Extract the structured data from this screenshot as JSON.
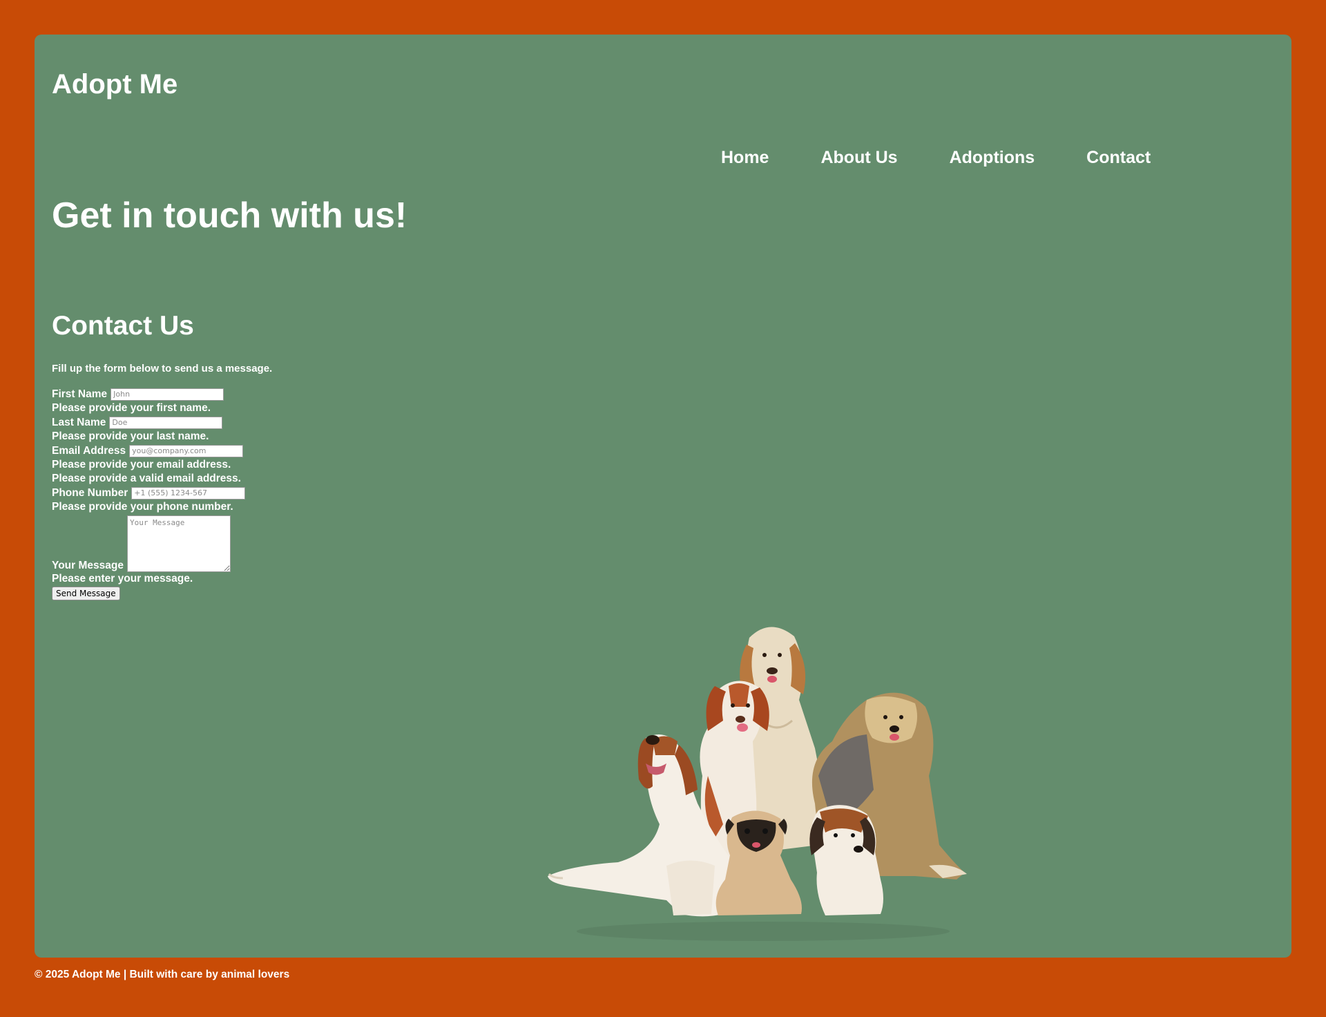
{
  "header": {
    "site_title": "Adopt Me"
  },
  "nav": {
    "items": [
      "Home",
      "About Us",
      "Adoptions",
      "Contact"
    ]
  },
  "hero": {
    "title": "Get in touch with us!"
  },
  "contact": {
    "heading": "Contact Us",
    "intro": "Fill up the form below to send us a message.",
    "first_name": {
      "label": "First Name",
      "placeholder": "John",
      "message": "Please provide your first name."
    },
    "last_name": {
      "label": "Last Name",
      "placeholder": "Doe",
      "message": "Please provide your last name."
    },
    "email": {
      "label": "Email Address",
      "placeholder": "you@company.com",
      "message_required": "Please provide your email address.",
      "message_invalid": "Please provide a valid email address."
    },
    "phone": {
      "label": "Phone Number",
      "placeholder": "+1 (555) 1234-567",
      "message": "Please provide your phone number."
    },
    "message": {
      "label": "Your Message",
      "placeholder": "Your Message",
      "error": "Please enter your message."
    },
    "submit_label": "Send Message"
  },
  "image": {
    "subject": "group-of-dogs-photo"
  },
  "footer": {
    "text": "© 2025 Adopt Me | Built with care by animal lovers"
  },
  "colors": {
    "page_background": "#c84b06",
    "panel_background": "#648d6d",
    "text": "#ffffff"
  }
}
